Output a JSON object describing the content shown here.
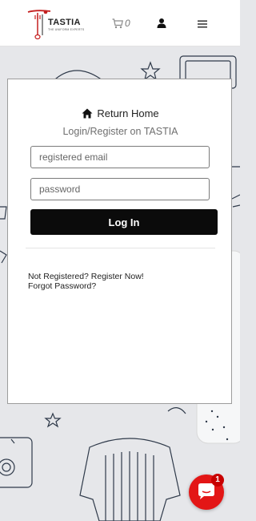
{
  "header": {
    "brand_name": "TASTIA",
    "brand_tagline": "THE UNIFORM EXPERTS",
    "cart_count": "0"
  },
  "login": {
    "return_home": "Return Home",
    "subtitle": "Login/Register on TASTIA",
    "email_placeholder": "registered email",
    "password_placeholder": "password",
    "login_button": "Log In",
    "register_link": "Not Registered? Register Now!",
    "forgot_link": "Forgot Password?"
  },
  "chat": {
    "badge_count": "1"
  },
  "icons": [
    "logo-icon",
    "cart-icon",
    "user-icon",
    "hamburger-icon",
    "home-icon",
    "chat-icon"
  ]
}
